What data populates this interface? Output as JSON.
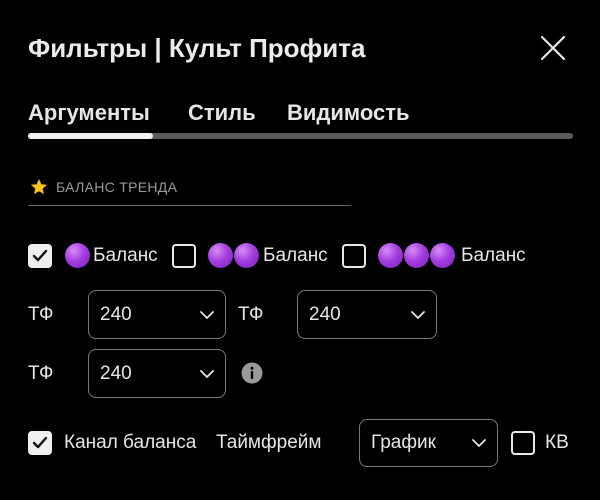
{
  "dialog": {
    "title": "Фильтры | Культ Профита"
  },
  "tabs": [
    {
      "label": "Аргументы",
      "active": true
    },
    {
      "label": "Стиль",
      "active": false
    },
    {
      "label": "Видимость",
      "active": false
    }
  ],
  "section": {
    "icon": "star-icon",
    "title": "БАЛАНС ТРЕНДА"
  },
  "balance_options": [
    {
      "label": "Баланс",
      "dots": 1,
      "checked": true
    },
    {
      "label": "Баланс",
      "dots": 2,
      "checked": false
    },
    {
      "label": "Баланс",
      "dots": 3,
      "checked": false
    }
  ],
  "timeframes": [
    {
      "label": "ТФ",
      "value": "240"
    },
    {
      "label": "ТФ",
      "value": "240"
    },
    {
      "label": "ТФ",
      "value": "240"
    }
  ],
  "channel": {
    "checkbox_label": "Канал баланса",
    "checked": true,
    "timeframe_label": "Таймфрейм",
    "timeframe_value": "График",
    "kv_label": "КВ",
    "kv_checked": false
  },
  "colors": {
    "background": "#000000",
    "text": "#e6e6e6",
    "muted": "#9a9a9a",
    "border": "#7a7a7a",
    "dot": "#a53de0"
  }
}
